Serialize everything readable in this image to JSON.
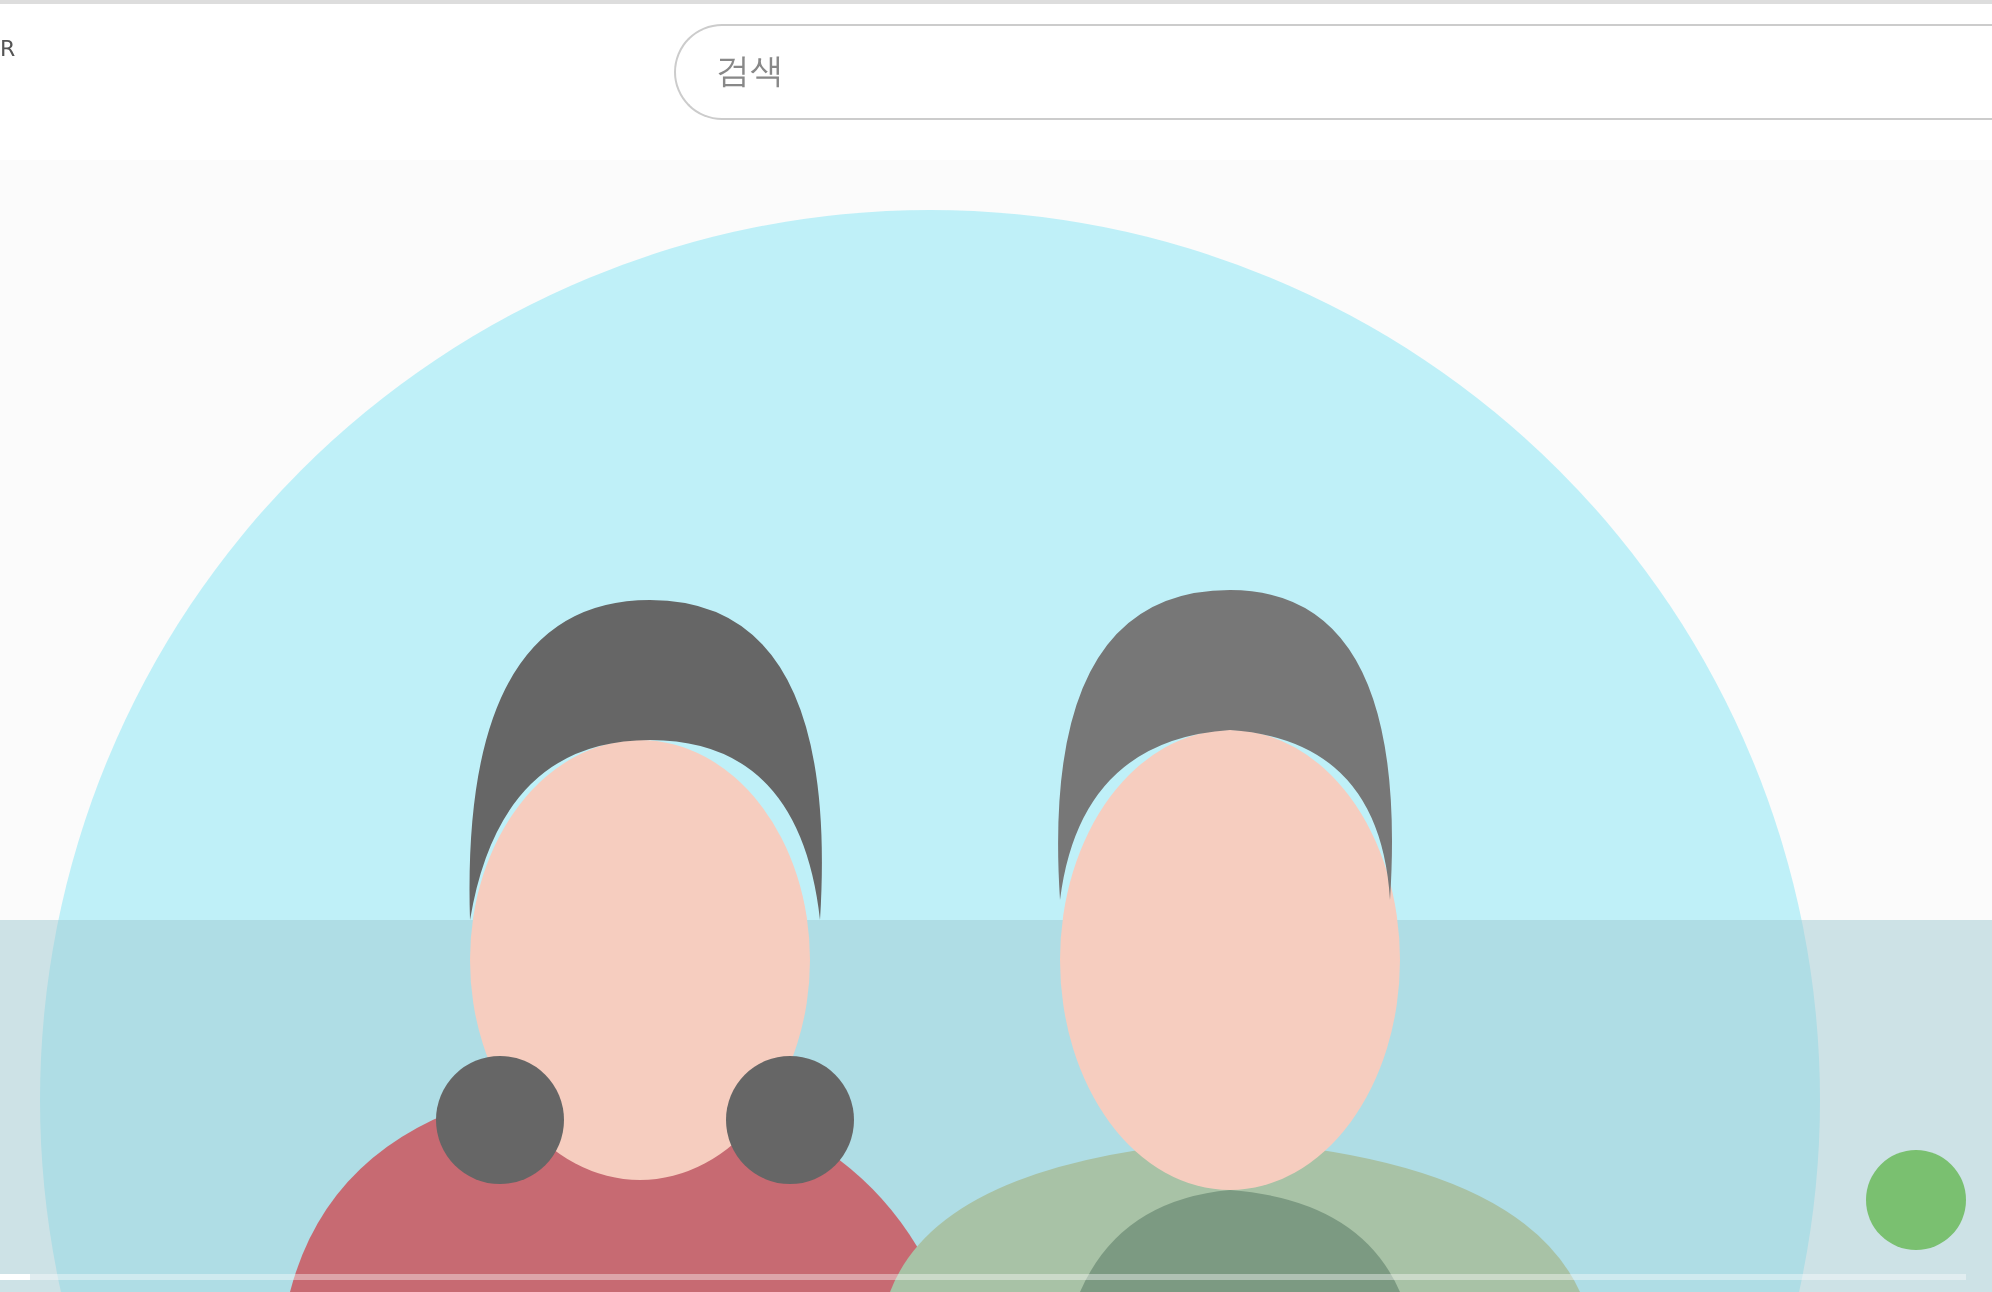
{
  "header": {
    "logo_text": "R",
    "search": {
      "placeholder": "검색"
    }
  },
  "video": {
    "kind": "picture",
    "progress": {
      "level": 0.015
    }
  }
}
